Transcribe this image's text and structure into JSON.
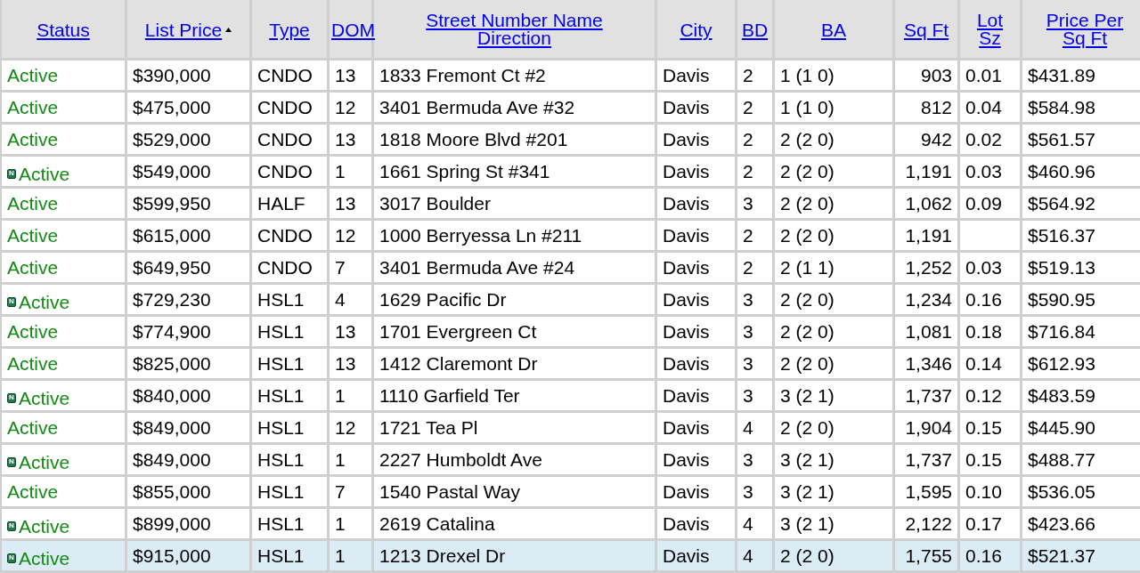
{
  "table": {
    "columns": [
      {
        "label": "Status",
        "sorted": false,
        "kind": "status"
      },
      {
        "label": "List Price",
        "sorted": true,
        "kind": "text"
      },
      {
        "label": "Type",
        "sorted": false,
        "kind": "text"
      },
      {
        "label": "DOM",
        "sorted": false,
        "kind": "text"
      },
      {
        "label": "Street Number Name Direction",
        "sorted": false,
        "kind": "text"
      },
      {
        "label": "City",
        "sorted": false,
        "kind": "text"
      },
      {
        "label": "BD",
        "sorted": false,
        "kind": "text"
      },
      {
        "label": "BA",
        "sorted": false,
        "kind": "text"
      },
      {
        "label": "Sq Ft",
        "sorted": false,
        "kind": "number"
      },
      {
        "label": "Lot Sz",
        "sorted": false,
        "kind": "text"
      },
      {
        "label": "Price Per Sq Ft",
        "sorted": false,
        "kind": "text"
      }
    ],
    "rows": [
      {
        "badge": "",
        "selected": false,
        "cells": [
          "Active",
          "$390,000",
          "CNDO",
          "13",
          "1833 Fremont Ct #2",
          "Davis",
          "2",
          "1 (1 0)",
          "903",
          "0.01",
          "$431.89"
        ]
      },
      {
        "badge": "",
        "selected": false,
        "cells": [
          "Active",
          "$475,000",
          "CNDO",
          "12",
          "3401 Bermuda Ave #32",
          "Davis",
          "2",
          "1 (1 0)",
          "812",
          "0.04",
          "$584.98"
        ]
      },
      {
        "badge": "",
        "selected": false,
        "cells": [
          "Active",
          "$529,000",
          "CNDO",
          "13",
          "1818 Moore Blvd #201",
          "Davis",
          "2",
          "2 (2 0)",
          "942",
          "0.02",
          "$561.57"
        ]
      },
      {
        "badge": "N",
        "selected": false,
        "cells": [
          "Active",
          "$549,000",
          "CNDO",
          "1",
          "1661 Spring St #341",
          "Davis",
          "2",
          "2 (2 0)",
          "1,191",
          "0.03",
          "$460.96"
        ]
      },
      {
        "badge": "",
        "selected": false,
        "cells": [
          "Active",
          "$599,950",
          "HALF",
          "13",
          "3017 Boulder",
          "Davis",
          "3",
          "2 (2 0)",
          "1,062",
          "0.09",
          "$564.92"
        ]
      },
      {
        "badge": "",
        "selected": false,
        "cells": [
          "Active",
          "$615,000",
          "CNDO",
          "12",
          "1000 Berryessa Ln #211",
          "Davis",
          "2",
          "2 (2 0)",
          "1,191",
          "",
          "$516.37"
        ]
      },
      {
        "badge": "",
        "selected": false,
        "cells": [
          "Active",
          "$649,950",
          "CNDO",
          "7",
          "3401 Bermuda Ave #24",
          "Davis",
          "2",
          "2 (1 1)",
          "1,252",
          "0.03",
          "$519.13"
        ]
      },
      {
        "badge": "N",
        "selected": false,
        "cells": [
          "Active",
          "$729,230",
          "HSL1",
          "4",
          "1629 Pacific Dr",
          "Davis",
          "3",
          "2 (2 0)",
          "1,234",
          "0.16",
          "$590.95"
        ]
      },
      {
        "badge": "",
        "selected": false,
        "cells": [
          "Active",
          "$774,900",
          "HSL1",
          "13",
          "1701 Evergreen Ct",
          "Davis",
          "3",
          "2 (2 0)",
          "1,081",
          "0.18",
          "$716.84"
        ]
      },
      {
        "badge": "",
        "selected": false,
        "cells": [
          "Active",
          "$825,000",
          "HSL1",
          "13",
          "1412 Claremont Dr",
          "Davis",
          "3",
          "2 (2 0)",
          "1,346",
          "0.14",
          "$612.93"
        ]
      },
      {
        "badge": "N",
        "selected": false,
        "cells": [
          "Active",
          "$840,000",
          "HSL1",
          "1",
          "1110 Garfield Ter",
          "Davis",
          "3",
          "3 (2 1)",
          "1,737",
          "0.12",
          "$483.59"
        ]
      },
      {
        "badge": "",
        "selected": false,
        "cells": [
          "Active",
          "$849,000",
          "HSL1",
          "12",
          "1721 Tea Pl",
          "Davis",
          "4",
          "2 (2 0)",
          "1,904",
          "0.15",
          "$445.90"
        ]
      },
      {
        "badge": "N",
        "selected": false,
        "cells": [
          "Active",
          "$849,000",
          "HSL1",
          "1",
          "2227 Humboldt Ave",
          "Davis",
          "3",
          "3 (2 1)",
          "1,737",
          "0.15",
          "$488.77"
        ]
      },
      {
        "badge": "",
        "selected": false,
        "cells": [
          "Active",
          "$855,000",
          "HSL1",
          "7",
          "1540 Pastal Way",
          "Davis",
          "3",
          "3 (2 1)",
          "1,595",
          "0.10",
          "$536.05"
        ]
      },
      {
        "badge": "N",
        "selected": false,
        "cells": [
          "Active",
          "$899,000",
          "HSL1",
          "1",
          "2619 Catalina",
          "Davis",
          "4",
          "3 (2 1)",
          "2,122",
          "0.17",
          "$423.66"
        ]
      },
      {
        "badge": "N",
        "selected": true,
        "cells": [
          "Active",
          "$915,000",
          "HSL1",
          "1",
          "1213 Drexel Dr",
          "Davis",
          "4",
          "2 (2 0)",
          "1,755",
          "0.16",
          "$521.37"
        ]
      }
    ]
  }
}
